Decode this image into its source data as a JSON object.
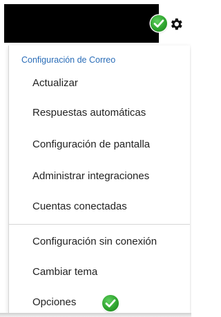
{
  "header": {
    "status_icon": "check-badge-icon",
    "settings_icon": "gear-icon",
    "accent_green": "#2fa52f"
  },
  "menu": {
    "section_title": "Configuración de Correo",
    "items": [
      {
        "label": "Actualizar"
      },
      {
        "label": "Respuestas automáticas"
      },
      {
        "label": "Configuración de pantalla"
      },
      {
        "label": "Administrar integraciones"
      },
      {
        "label": "Cuentas conectadas"
      },
      {
        "label": "Configuración sin conexión"
      },
      {
        "label": "Cambiar tema"
      },
      {
        "label": "Opciones",
        "badge_icon": "check-badge-icon"
      }
    ],
    "title_color": "#2a6db8"
  }
}
